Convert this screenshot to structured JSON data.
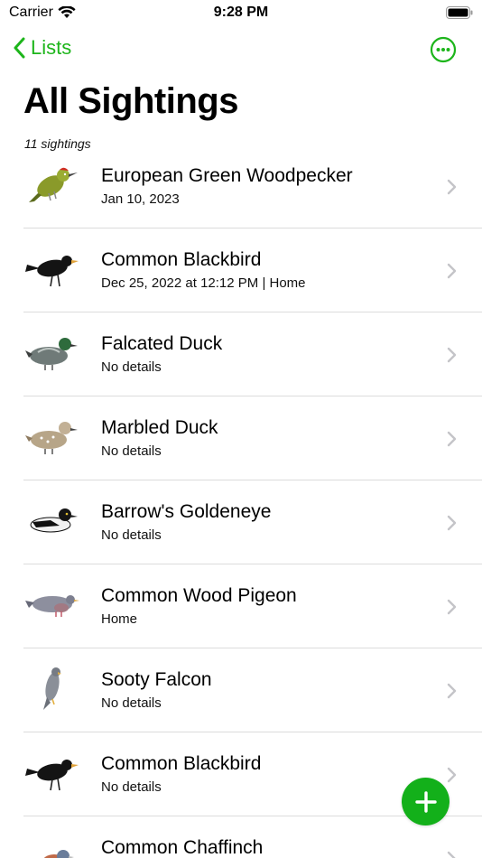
{
  "status": {
    "carrier": "Carrier",
    "time": "9:28 PM"
  },
  "nav": {
    "back_label": "Lists",
    "more_icon": "ellipsis-circle-icon"
  },
  "header": {
    "title": "All Sightings",
    "count": "11 sightings"
  },
  "colors": {
    "accent": "#1db51b",
    "fab": "#13b01a",
    "separator": "#dcdcdc",
    "chevron": "#c4c4c8"
  },
  "sightings": [
    {
      "name": "European Green Woodpecker",
      "detail": "Jan 10, 2023",
      "icon": "green-woodpecker-icon"
    },
    {
      "name": "Common Blackbird",
      "detail": "Dec 25, 2022 at 12:12 PM | Home",
      "icon": "blackbird-icon"
    },
    {
      "name": "Falcated Duck",
      "detail": "No details",
      "icon": "falcated-duck-icon"
    },
    {
      "name": "Marbled Duck",
      "detail": "No details",
      "icon": "marbled-duck-icon"
    },
    {
      "name": "Barrow's Goldeneye",
      "detail": "No details",
      "icon": "goldeneye-icon"
    },
    {
      "name": "Common Wood Pigeon",
      "detail": "Home",
      "icon": "wood-pigeon-icon"
    },
    {
      "name": "Sooty Falcon",
      "detail": "No details",
      "icon": "sooty-falcon-icon"
    },
    {
      "name": "Common Blackbird",
      "detail": "No details",
      "icon": "blackbird-icon"
    },
    {
      "name": "Common Chaffinch",
      "detail": "",
      "icon": "chaffinch-icon"
    }
  ],
  "fab_icon": "plus-icon"
}
